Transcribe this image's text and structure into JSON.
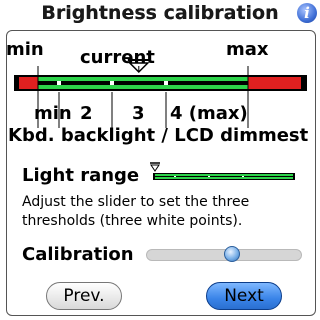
{
  "window": {
    "title": "Brightness calibration",
    "info_icon": "info-icon",
    "info_glyph": "i"
  },
  "diagram": {
    "min_label": "min",
    "max_label": "max",
    "current_label": "current",
    "levels": [
      "min",
      "2",
      "3",
      "4 (max)"
    ],
    "caption": "Kbd. backlight / LCD dimmest",
    "current_position": 0.48,
    "colors": {
      "green": "#2dd34a",
      "red": "#e02020",
      "bar_border": "#000000",
      "point": "#ffffff"
    }
  },
  "light_range": {
    "label": "Light range"
  },
  "description": "Adjust the slider to set the three thresholds (three white points).",
  "calibration": {
    "label": "Calibration",
    "value": 0.56
  },
  "buttons": {
    "prev_label": "Prev.",
    "next_label": "Next"
  }
}
